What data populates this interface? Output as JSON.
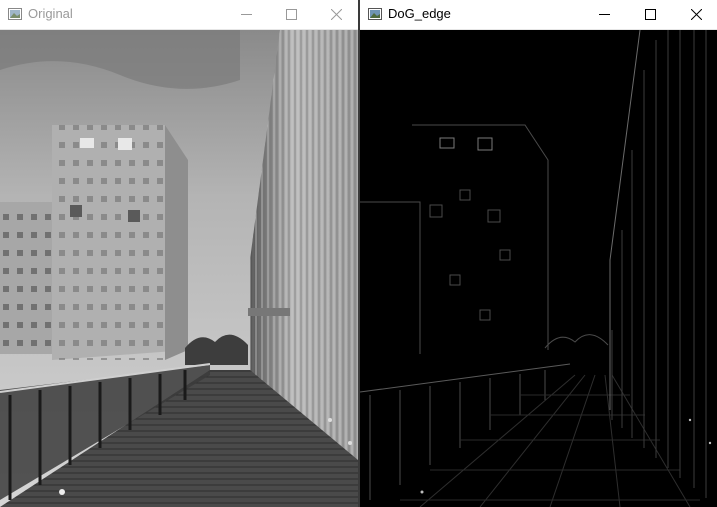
{
  "windows": {
    "left": {
      "title": "Original",
      "active": false,
      "image_icon": "image-icon"
    },
    "right": {
      "title": "DoG_edge",
      "active": true,
      "image_icon": "image-icon"
    }
  },
  "controls": {
    "minimize": "minimize-icon",
    "maximize": "maximize-icon",
    "close": "close-icon"
  },
  "colors": {
    "titlebar": "#ffffff",
    "inactive_title": "#9a9a9a",
    "active_title": "#000000",
    "edge_background": "#000000"
  }
}
